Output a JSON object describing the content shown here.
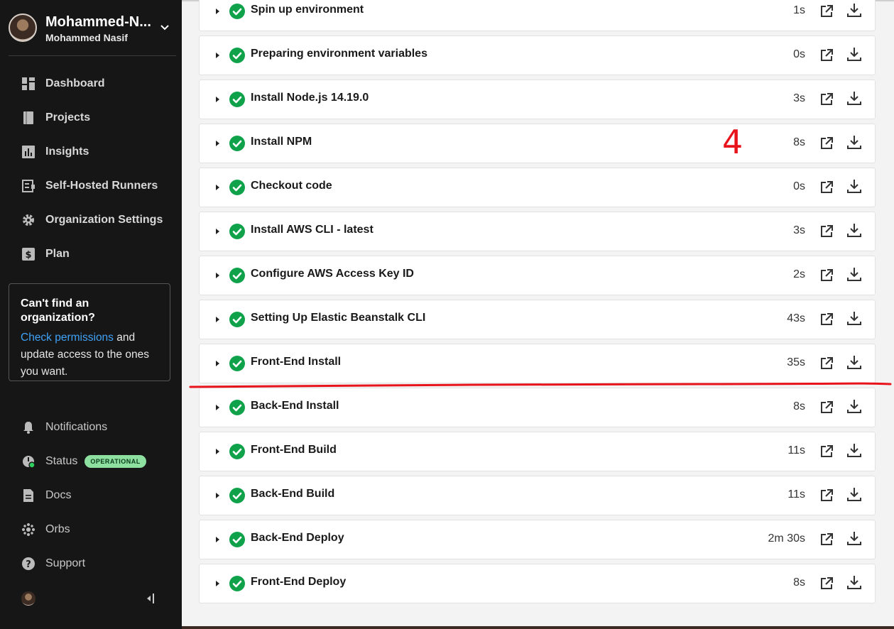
{
  "sidebar": {
    "org_name": "Mohammed-N...",
    "user_name": "Mohammed Nasif",
    "nav": [
      {
        "label": "Dashboard",
        "icon": "dashboard-icon"
      },
      {
        "label": "Projects",
        "icon": "projects-icon"
      },
      {
        "label": "Insights",
        "icon": "insights-icon"
      },
      {
        "label": "Self-Hosted Runners",
        "icon": "runners-icon"
      },
      {
        "label": "Organization Settings",
        "icon": "gear-icon"
      },
      {
        "label": "Plan",
        "icon": "plan-icon"
      }
    ],
    "cta": {
      "title": "Can't find an organization?",
      "link": "Check permissions",
      "text": " and update access to the ones you want."
    },
    "bottom_nav": [
      {
        "label": "Notifications",
        "icon": "bell-icon"
      },
      {
        "label": "Status",
        "icon": "status-icon",
        "badge": "OPERATIONAL"
      },
      {
        "label": "Docs",
        "icon": "docs-icon"
      },
      {
        "label": "Orbs",
        "icon": "orbs-icon"
      },
      {
        "label": "Support",
        "icon": "help-icon"
      }
    ]
  },
  "steps": [
    {
      "title": "Spin up environment",
      "duration": "1s"
    },
    {
      "title": "Preparing environment variables",
      "duration": "0s"
    },
    {
      "title": "Install Node.js 14.19.0",
      "duration": "3s"
    },
    {
      "title": "Install NPM",
      "duration": "8s"
    },
    {
      "title": "Checkout code",
      "duration": "0s"
    },
    {
      "title": "Install AWS CLI - latest",
      "duration": "3s"
    },
    {
      "title": "Configure AWS Access Key ID",
      "duration": "2s"
    },
    {
      "title": "Setting Up Elastic Beanstalk CLI",
      "duration": "43s"
    },
    {
      "title": "Front-End Install",
      "duration": "35s"
    },
    {
      "title": "Back-End Install",
      "duration": "8s"
    },
    {
      "title": "Front-End Build",
      "duration": "11s"
    },
    {
      "title": "Back-End Build",
      "duration": "11s"
    },
    {
      "title": "Back-End Deploy",
      "duration": "2m 30s"
    },
    {
      "title": "Front-End Deploy",
      "duration": "8s"
    }
  ],
  "annotation": {
    "number": "4",
    "color": "#e8141c"
  },
  "colors": {
    "success": "#0fa24a",
    "sidebar_bg": "#161616",
    "link": "#3fa2f7",
    "badge_bg": "#8ee0a0"
  }
}
